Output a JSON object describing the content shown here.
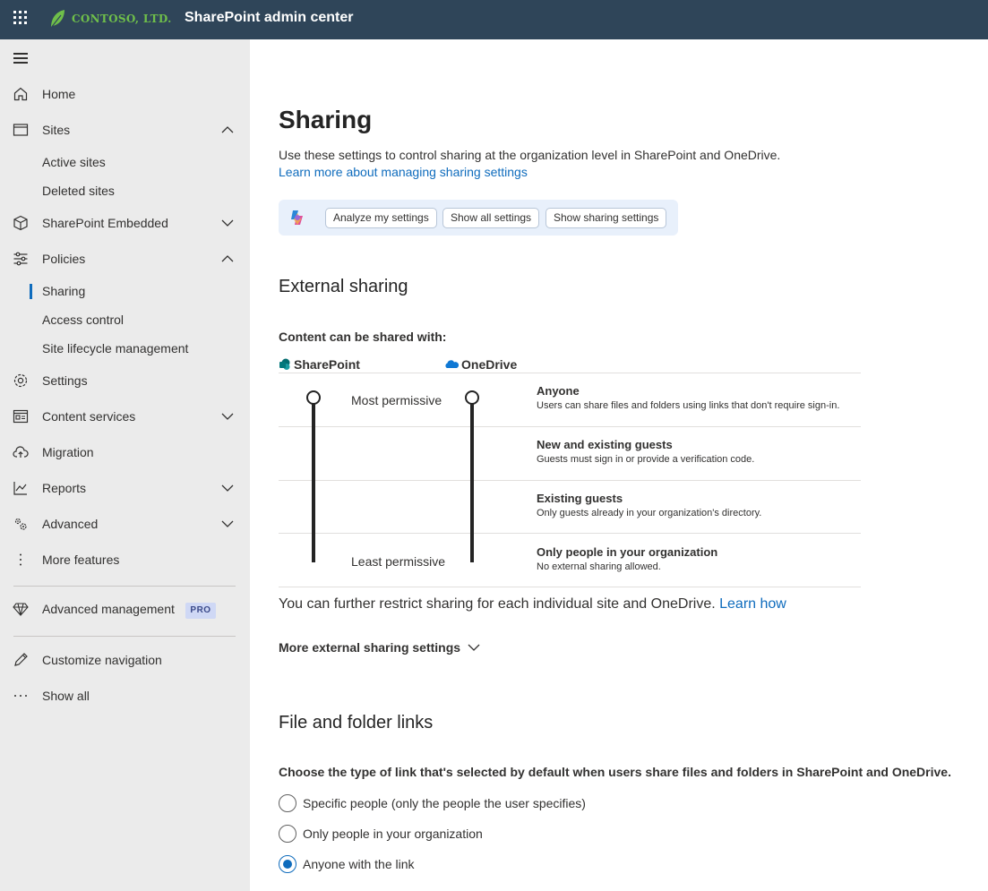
{
  "header": {
    "logo_text": "CONTOSO, LTD.",
    "app_title": "SharePoint admin center"
  },
  "sidebar": {
    "items": [
      {
        "label": "Home",
        "icon": "home-icon"
      },
      {
        "label": "Sites",
        "icon": "sites-icon",
        "expanded": true,
        "children": [
          "Active sites",
          "Deleted sites"
        ]
      },
      {
        "label": "SharePoint Embedded",
        "icon": "cube-icon",
        "expanded": false
      },
      {
        "label": "Policies",
        "icon": "policies-icon",
        "expanded": true,
        "children": [
          "Sharing",
          "Access control",
          "Site lifecycle management"
        ],
        "selected_child": "Sharing"
      },
      {
        "label": "Settings",
        "icon": "gear-icon"
      },
      {
        "label": "Content services",
        "icon": "content-services-icon",
        "expanded": false
      },
      {
        "label": "Migration",
        "icon": "cloud-upload-icon"
      },
      {
        "label": "Reports",
        "icon": "chart-icon",
        "expanded": false
      },
      {
        "label": "Advanced",
        "icon": "advanced-icon",
        "expanded": false
      },
      {
        "label": "More features",
        "icon": "more-vertical-icon"
      }
    ],
    "advanced_management": {
      "label": "Advanced management",
      "badge": "PRO",
      "icon": "diamond-icon"
    },
    "customize_navigation": "Customize navigation",
    "show_all": "Show all"
  },
  "main": {
    "title": "Sharing",
    "description": "Use these settings to control sharing at the organization level in SharePoint and OneDrive.",
    "learn_more_link": "Learn more about managing sharing settings",
    "copilot_prompts": [
      "Analyze my settings",
      "Show all settings",
      "Show sharing settings"
    ],
    "external_sharing": {
      "heading": "External sharing",
      "content_label": "Content can be shared with:",
      "col_sharepoint": "SharePoint",
      "col_onedrive": "OneDrive",
      "most_permissive": "Most permissive",
      "least_permissive": "Least permissive",
      "levels": [
        {
          "title": "Anyone",
          "desc": "Users can share files and folders using links that don't require sign-in."
        },
        {
          "title": "New and existing guests",
          "desc": "Guests must sign in or provide a verification code."
        },
        {
          "title": "Existing guests",
          "desc": "Only guests already in your organization's directory."
        },
        {
          "title": "Only people in your organization",
          "desc": "No external sharing allowed."
        }
      ],
      "sharepoint_level": "Anyone",
      "onedrive_level": "Anyone",
      "restrict_text": "You can further restrict sharing for each individual site and OneDrive.",
      "restrict_link": "Learn how",
      "more_settings": "More external sharing settings"
    },
    "file_folder_links": {
      "heading": "File and folder links",
      "question": "Choose the type of link that's selected by default when users share files and folders in SharePoint and OneDrive.",
      "options": [
        {
          "label": "Specific people (only the people the user specifies)",
          "checked": false
        },
        {
          "label": "Only people in your organization",
          "checked": false
        },
        {
          "label": "Anyone with the link",
          "checked": true
        }
      ]
    }
  }
}
